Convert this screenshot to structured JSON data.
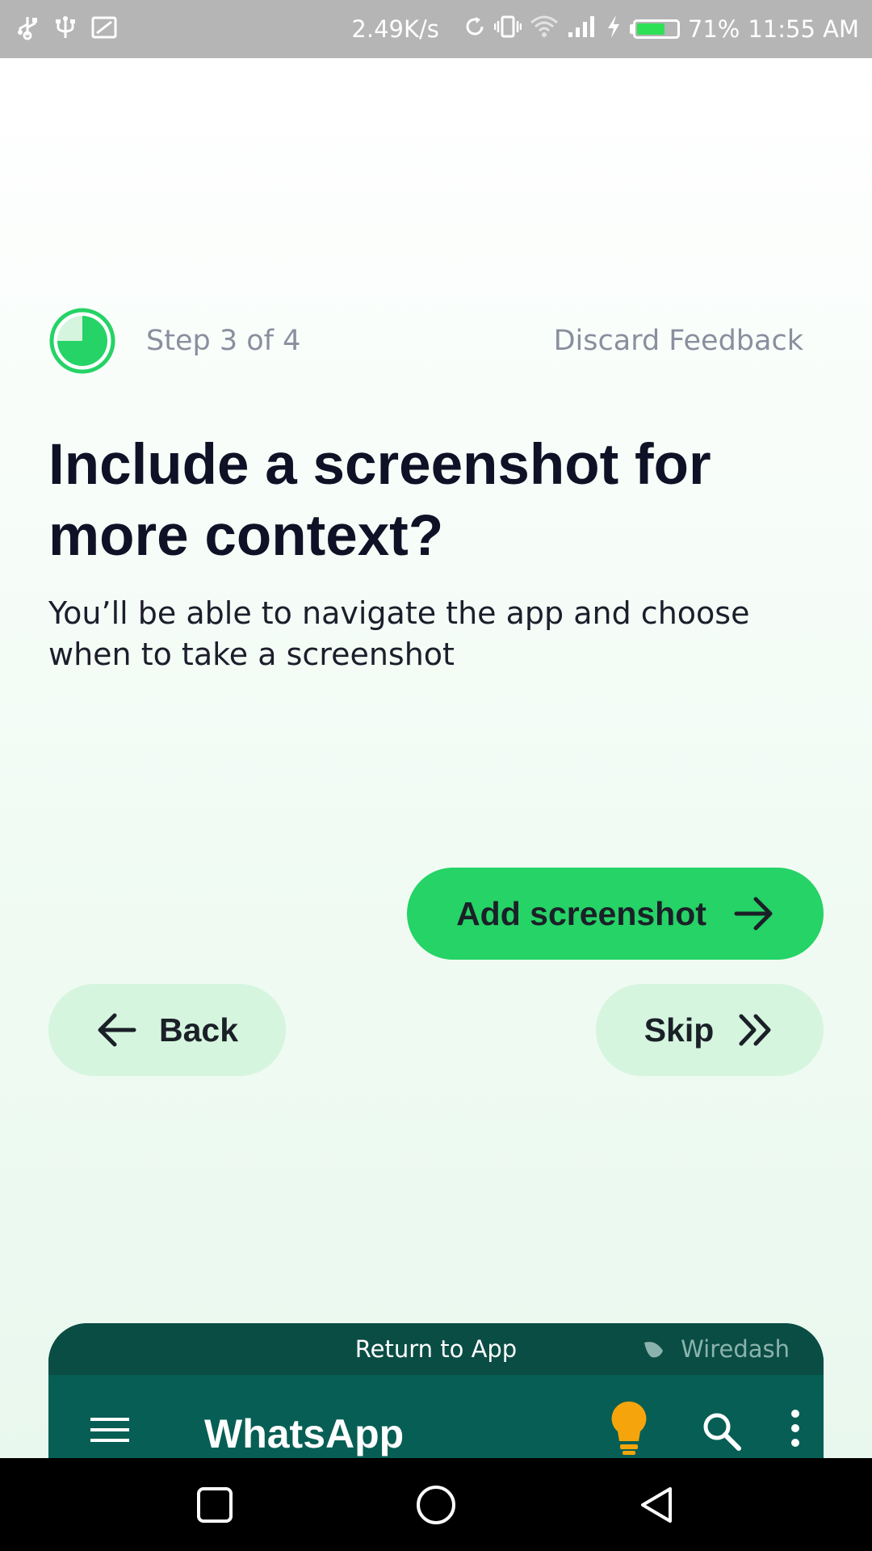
{
  "status_bar": {
    "net_speed": "2.49K/s",
    "battery_percent": "71%",
    "battery_level": 0.71,
    "time": "11:55 AM",
    "icons": [
      "usb-icon",
      "usb-debug-icon",
      "cast-icon",
      "sync-icon",
      "vibrate-icon",
      "wifi-icon",
      "signal-icon",
      "charging-icon",
      "battery-icon"
    ]
  },
  "feedback": {
    "step_label": "Step 3 of 4",
    "progress": 0.75,
    "discard_label": "Discard Feedback",
    "title": "Include a screenshot for more context?",
    "subtitle": "You’ll be able to navigate the app and choose when to take a screenshot",
    "add_screenshot_label": "Add screenshot",
    "back_label": "Back",
    "skip_label": "Skip"
  },
  "app_panel": {
    "return_label": "Return to App",
    "brand": "Wiredash",
    "app_title": "WhatsApp"
  },
  "colors": {
    "accent": "#25d366",
    "accent_light": "#d6f5df",
    "whatsapp_dark": "#075e54",
    "bulb": "#f5a50b"
  }
}
